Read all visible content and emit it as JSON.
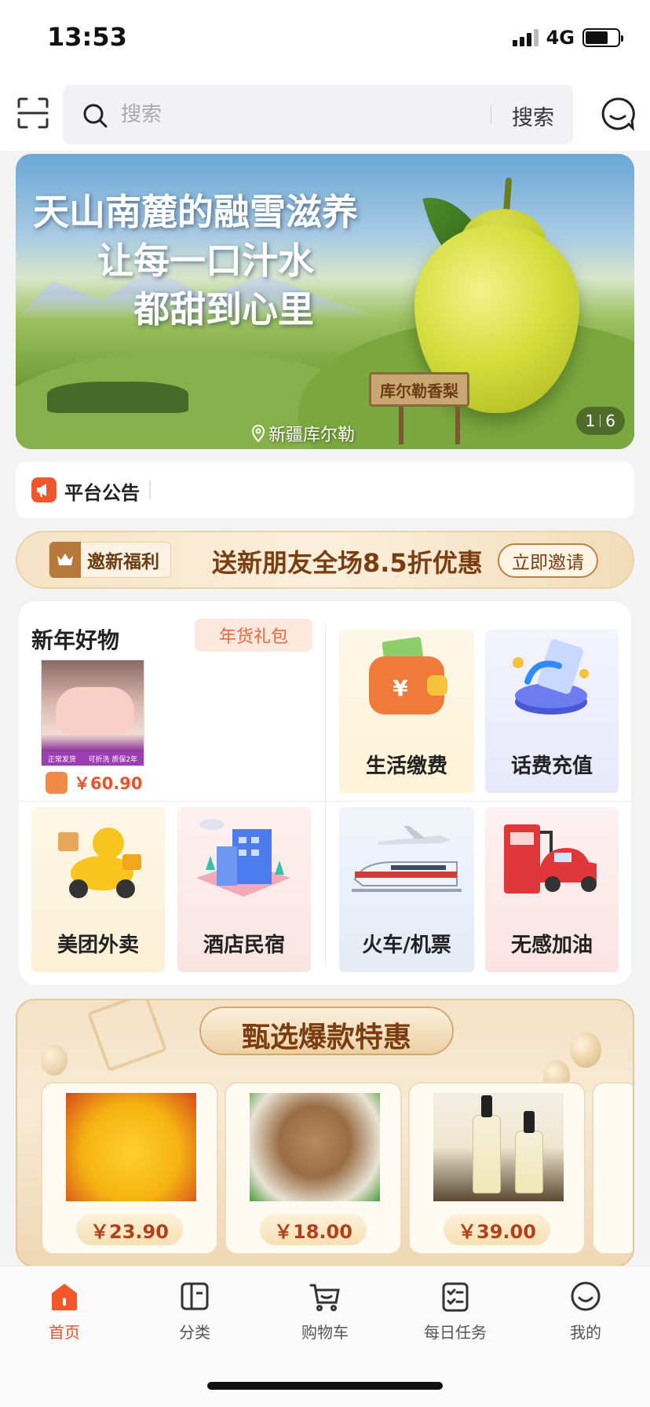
{
  "status_bar": {
    "time": "13:53",
    "network": "4G"
  },
  "search": {
    "placeholder": "搜索",
    "button_label": "搜索"
  },
  "banner": {
    "line1": "天山南麓的融雪滋养",
    "line2": "让每一口汁水",
    "line3": "都甜到心里",
    "sign_text": "库尔勒香梨",
    "location": "新疆库尔勒",
    "current_page": "1",
    "total_pages": "6"
  },
  "notice": {
    "label": "平台公告"
  },
  "invite": {
    "tag_label": "邀新福利",
    "headline": "送新朋友全场8.5折优惠",
    "button_label": "立即邀请"
  },
  "new_year": {
    "title": "新年好物",
    "tag": "年货礼包",
    "product_strip_left": "正常发货",
    "product_strip_right": "可折洗 质保2年",
    "price": "￥60.90"
  },
  "services": [
    {
      "id": "life",
      "label": "生活缴费",
      "icon": "wallet-icon"
    },
    {
      "id": "phone",
      "label": "话费充值",
      "icon": "phone-recharge-icon"
    },
    {
      "id": "meituan",
      "label": "美团外卖",
      "icon": "delivery-scooter-icon"
    },
    {
      "id": "hotel",
      "label": "酒店民宿",
      "icon": "hotel-icon"
    },
    {
      "id": "train",
      "label": "火车/机票",
      "icon": "train-plane-icon"
    },
    {
      "id": "gas",
      "label": "无感加油",
      "icon": "gas-station-icon"
    }
  ],
  "deals": {
    "title": "甄选爆款特惠",
    "items": [
      {
        "price": "￥23.90",
        "image": "mango-image"
      },
      {
        "price": "￥18.00",
        "image": "longan-image"
      },
      {
        "price": "￥39.00",
        "image": "rice-wine-image"
      }
    ]
  },
  "tabbar": {
    "items": [
      {
        "label": "首页",
        "icon": "home-icon",
        "active": true
      },
      {
        "label": "分类",
        "icon": "category-icon",
        "active": false
      },
      {
        "label": "购物车",
        "icon": "cart-icon",
        "active": false
      },
      {
        "label": "每日任务",
        "icon": "task-icon",
        "active": false
      },
      {
        "label": "我的",
        "icon": "profile-icon",
        "active": false
      }
    ]
  },
  "colors": {
    "accent": "#e8532d",
    "gold_text": "#7a3d10"
  }
}
